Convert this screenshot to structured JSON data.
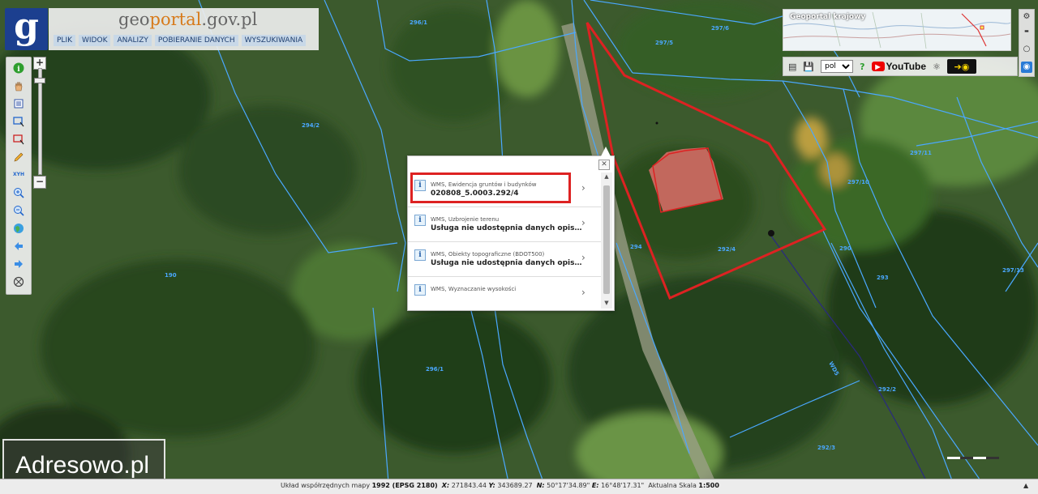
{
  "header": {
    "logo_letter": "g",
    "brand_pre": "geo",
    "brand_mid": "portal",
    "brand_post": ".gov.pl",
    "menu": [
      "PLIK",
      "WIDOK",
      "ANALIZY",
      "POBIERANIE DANYCH",
      "WYSZUKIWANIA"
    ]
  },
  "overview": {
    "title": "Geoportal krajowy"
  },
  "right_toolbar": {
    "language": "pol",
    "youtube_label": "YouTube"
  },
  "map": {
    "parcel_labels": [
      "296/1",
      "297/5",
      "297/6",
      "294/2",
      "297/11",
      "297/10",
      "294",
      "292/4",
      "290",
      "293",
      "297/13",
      "190",
      "296/1",
      "292/2",
      "292/3",
      "WD5"
    ],
    "colors": {
      "parcel_line": "#4aa8ff",
      "selection": "#dd2222"
    }
  },
  "popup": {
    "items": [
      {
        "source": "WMS, Ewidencja gruntów i budynków",
        "value": "020808_5.0003.292/4"
      },
      {
        "source": "WMS, Uzbrojenie terenu",
        "value": "Usługa nie udostępnia danych opisowych"
      },
      {
        "source": "WMS, Obiekty topograficzne (BDOT500)",
        "value": "Usługa nie udostępnia danych opisowych"
      },
      {
        "source": "WMS, Wyznaczanie wysokości",
        "value": ""
      }
    ]
  },
  "status": {
    "label_system": "Układ współrzędnych mapy",
    "system": "1992 (EPSG 2180)",
    "x_label": "X:",
    "x_value": "271843.44",
    "y_label": "Y:",
    "y_value": "343689.27",
    "n_label": "N:",
    "n_value": "50°17'34.89\"",
    "e_label": "E:",
    "e_value": "16°48'17.31\"",
    "scale_label": "Aktualna Skala",
    "scale_value": "1:500"
  },
  "watermark": "Adresowo.pl"
}
